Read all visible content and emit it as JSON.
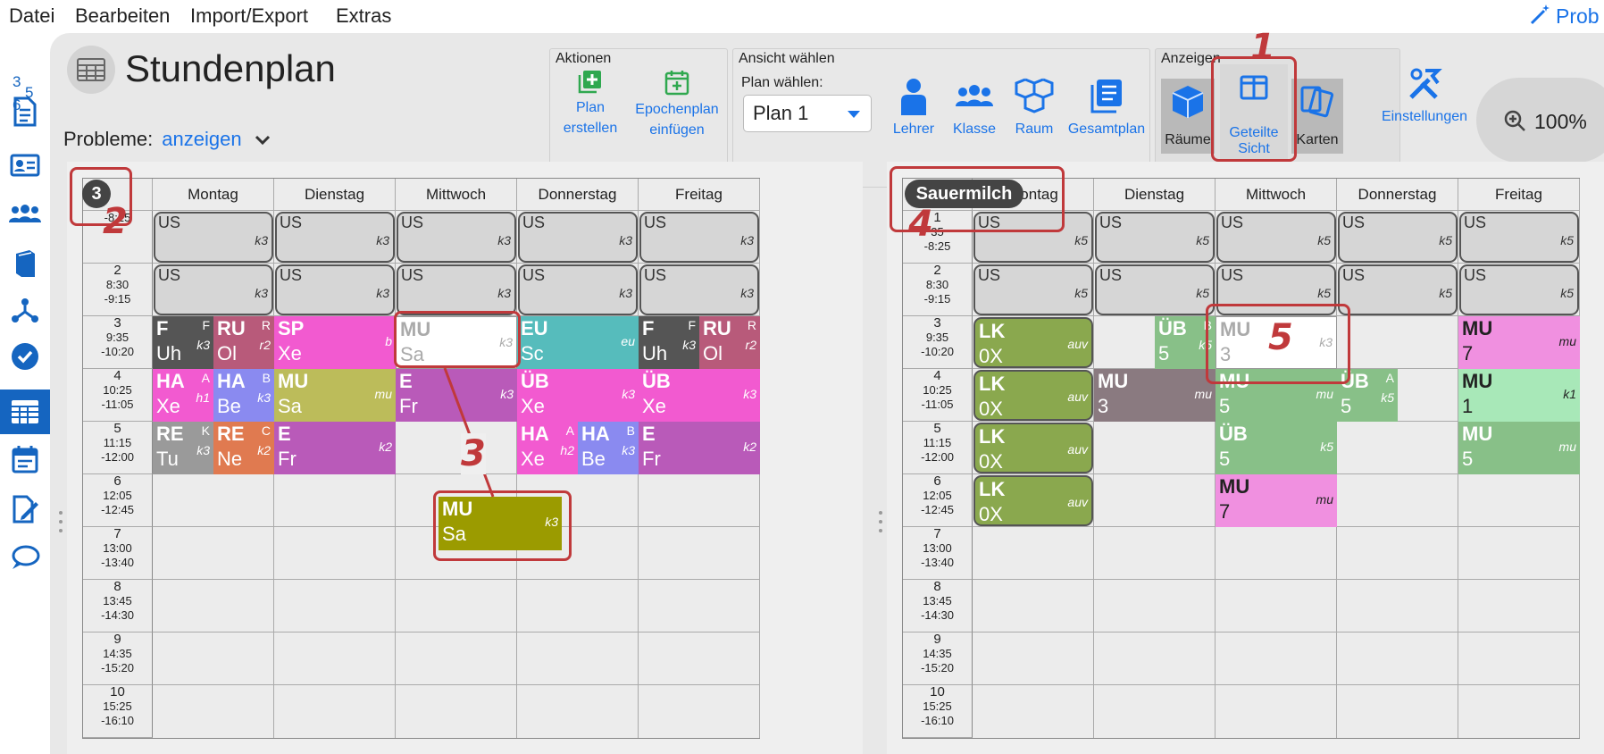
{
  "menu": [
    "Datei",
    "Bearbeiten",
    "Import/Export",
    "Extras"
  ],
  "help_label": "Prob",
  "logo_text": "365",
  "title": "Stundenplan",
  "probleme": {
    "label": "Probleme:",
    "link": "anzeigen"
  },
  "groups": {
    "aktionen": "Aktionen",
    "ansicht": "Ansicht wählen",
    "anzeigen": "Anzeigen"
  },
  "toolbar": {
    "plan_erstellen": [
      "Plan",
      "erstellen"
    ],
    "epochenplan": [
      "Epochenplan",
      "einfügen"
    ],
    "plan_label": "Plan wählen:",
    "plan_value": "Plan 1",
    "lehrer": "Lehrer",
    "klasse": "Klasse",
    "raum": "Raum",
    "gesamtplan": "Gesamtplan",
    "raeume": "Räume",
    "geteilte": [
      "Geteilte",
      "Sicht"
    ],
    "karten": "Karten",
    "einstellungen": "Einstellungen",
    "zoom": "100%"
  },
  "days": [
    "Montag",
    "Dienstag",
    "Mittwoch",
    "Donnerstag",
    "Freitag"
  ],
  "periods": [
    {
      "n": "1",
      "from": "",
      "to": "-8:25"
    },
    {
      "n": "2",
      "from": "8:30",
      "to": "-9:15"
    },
    {
      "n": "3",
      "from": "9:35",
      "to": "-10:20"
    },
    {
      "n": "4",
      "from": "10:25",
      "to": "-11:05"
    },
    {
      "n": "5",
      "from": "11:15",
      "to": "-12:00"
    },
    {
      "n": "6",
      "from": "12:05",
      "to": "-12:45"
    },
    {
      "n": "7",
      "from": "13:00",
      "to": "-13:40"
    },
    {
      "n": "8",
      "from": "13:45",
      "to": "-14:30"
    },
    {
      "n": "9",
      "from": "14:35",
      "to": "-15:20"
    },
    {
      "n": "10",
      "from": "15:25",
      "to": "-16:10"
    }
  ],
  "left_periods_p1": {
    "n": "",
    "from": "",
    "to": "-8:25"
  },
  "right_periods_p1": {
    "n": "1",
    "from": "35",
    "to": "-8:25"
  },
  "left": {
    "badge": "3",
    "lessons": [
      {
        "d": 0,
        "p": 0,
        "w": 1,
        "sub": "US",
        "rm": "k3",
        "style": "us"
      },
      {
        "d": 1,
        "p": 0,
        "w": 1,
        "sub": "US",
        "rm": "k3",
        "style": "us"
      },
      {
        "d": 2,
        "p": 0,
        "w": 1,
        "sub": "US",
        "rm": "k3",
        "style": "us"
      },
      {
        "d": 3,
        "p": 0,
        "w": 1,
        "sub": "US",
        "rm": "k3",
        "style": "us"
      },
      {
        "d": 4,
        "p": 0,
        "w": 1,
        "sub": "US",
        "rm": "k3",
        "style": "us"
      },
      {
        "d": 0,
        "p": 1,
        "w": 1,
        "sub": "US",
        "rm": "k3",
        "style": "us"
      },
      {
        "d": 1,
        "p": 1,
        "w": 1,
        "sub": "US",
        "rm": "k3",
        "style": "us"
      },
      {
        "d": 2,
        "p": 1,
        "w": 1,
        "sub": "US",
        "rm": "k3",
        "style": "us"
      },
      {
        "d": 3,
        "p": 1,
        "w": 1,
        "sub": "US",
        "rm": "k3",
        "style": "us"
      },
      {
        "d": 4,
        "p": 1,
        "w": 1,
        "sub": "US",
        "rm": "k3",
        "style": "us"
      },
      {
        "d": 0,
        "p": 2,
        "w": 0.5,
        "o": 0,
        "sub": "F",
        "tch": "Uh",
        "rm": "k3",
        "sup": "F",
        "color": "#555555"
      },
      {
        "d": 0,
        "p": 2,
        "w": 0.5,
        "o": 0.5,
        "sub": "RU",
        "tch": "Ol",
        "rm": "r2",
        "sup": "R",
        "color": "#b85a7a"
      },
      {
        "d": 1,
        "p": 2,
        "w": 1,
        "sub": "SP",
        "tch": "Xe",
        "rm": "b",
        "color": "#f25ad0"
      },
      {
        "d": 2,
        "p": 2,
        "w": 1,
        "sub": "MU",
        "tch": "Sa",
        "rm": "k3",
        "style": "ghost"
      },
      {
        "d": 3,
        "p": 2,
        "w": 1,
        "sub": "EU",
        "tch": "Sc",
        "rm": "eu",
        "color": "#56bcbc"
      },
      {
        "d": 4,
        "p": 2,
        "w": 0.5,
        "o": 0,
        "sub": "F",
        "tch": "Uh",
        "rm": "k3",
        "sup": "F",
        "color": "#555555"
      },
      {
        "d": 4,
        "p": 2,
        "w": 0.5,
        "o": 0.5,
        "sub": "RU",
        "tch": "Ol",
        "rm": "r2",
        "sup": "R",
        "color": "#b85a7a"
      },
      {
        "d": 0,
        "p": 3,
        "w": 0.5,
        "o": 0,
        "sub": "HA",
        "tch": "Xe",
        "rm": "h1",
        "sup": "A",
        "color": "#f25ad0"
      },
      {
        "d": 0,
        "p": 3,
        "w": 0.5,
        "o": 0.5,
        "sub": "HA",
        "tch": "Be",
        "rm": "k3",
        "sup": "B",
        "color": "#8a8af0"
      },
      {
        "d": 1,
        "p": 3,
        "w": 1,
        "sub": "MU",
        "tch": "Sa",
        "rm": "mu",
        "color": "#bcbc5a"
      },
      {
        "d": 2,
        "p": 3,
        "w": 1,
        "sub": "E",
        "tch": "Fr",
        "rm": "k3",
        "color": "#b95ab9"
      },
      {
        "d": 3,
        "p": 3,
        "w": 1,
        "sub": "ÜB",
        "tch": "Xe",
        "rm": "k3",
        "color": "#f25ad0"
      },
      {
        "d": 4,
        "p": 3,
        "w": 1,
        "sub": "ÜB",
        "tch": "Xe",
        "rm": "k3",
        "color": "#f25ad0"
      },
      {
        "d": 0,
        "p": 4,
        "w": 0.5,
        "o": 0,
        "sub": "RE",
        "tch": "Tu",
        "rm": "k3",
        "sup": "K",
        "color": "#9a9a9a"
      },
      {
        "d": 0,
        "p": 4,
        "w": 0.5,
        "o": 0.5,
        "sub": "RE",
        "tch": "Ne",
        "rm": "k2",
        "sup": "C",
        "color": "#e07a50"
      },
      {
        "d": 1,
        "p": 4,
        "w": 1,
        "sub": "E",
        "tch": "Fr",
        "rm": "k2",
        "color": "#b95ab9"
      },
      {
        "d": 3,
        "p": 4,
        "w": 0.5,
        "o": 0,
        "sub": "HA",
        "tch": "Xe",
        "rm": "h2",
        "sup": "A",
        "color": "#f25ad0"
      },
      {
        "d": 3,
        "p": 4,
        "w": 0.5,
        "o": 0.5,
        "sub": "HA",
        "tch": "Be",
        "rm": "k3",
        "sup": "B",
        "color": "#8a8af0"
      },
      {
        "d": 4,
        "p": 4,
        "w": 1,
        "sub": "E",
        "tch": "Fr",
        "rm": "k2",
        "color": "#b95ab9"
      }
    ],
    "dragged": {
      "sub": "MU",
      "tch": "Sa",
      "rm": "k3",
      "color": "#9b9b00"
    }
  },
  "right": {
    "badge": "Sauermilch",
    "lessons": [
      {
        "d": 0,
        "p": 0,
        "w": 1,
        "sub": "US",
        "rm": "k5",
        "style": "us"
      },
      {
        "d": 1,
        "p": 0,
        "w": 1,
        "sub": "US",
        "rm": "k5",
        "style": "us"
      },
      {
        "d": 2,
        "p": 0,
        "w": 1,
        "sub": "US",
        "rm": "k5",
        "style": "us"
      },
      {
        "d": 3,
        "p": 0,
        "w": 1,
        "sub": "US",
        "rm": "k5",
        "style": "us"
      },
      {
        "d": 4,
        "p": 0,
        "w": 1,
        "sub": "US",
        "rm": "k5",
        "style": "us"
      },
      {
        "d": 0,
        "p": 1,
        "w": 1,
        "sub": "US",
        "rm": "k5",
        "style": "us"
      },
      {
        "d": 1,
        "p": 1,
        "w": 1,
        "sub": "US",
        "rm": "k5",
        "style": "us"
      },
      {
        "d": 2,
        "p": 1,
        "w": 1,
        "sub": "US",
        "rm": "k5",
        "style": "us"
      },
      {
        "d": 3,
        "p": 1,
        "w": 1,
        "sub": "US",
        "rm": "k5",
        "style": "us"
      },
      {
        "d": 4,
        "p": 1,
        "w": 1,
        "sub": "US",
        "rm": "k5",
        "style": "us"
      },
      {
        "d": 0,
        "p": 2,
        "w": 1,
        "sub": "LK",
        "tch": "0X",
        "rm": "auv",
        "color": "#8aa84e",
        "style": "rounded"
      },
      {
        "d": 1,
        "p": 2,
        "w": 0.5,
        "o": 0.5,
        "sub": "ÜB",
        "tch": "5",
        "rm": "k5",
        "sup": "B",
        "color": "#88c088"
      },
      {
        "d": 2,
        "p": 2,
        "w": 1,
        "sub": "MU",
        "tch": "3",
        "rm": "k3",
        "style": "ghost"
      },
      {
        "d": 4,
        "p": 2,
        "w": 1,
        "sub": "MU",
        "tch": "7",
        "rm": "mu",
        "color": "#f090e0",
        "dark": true
      },
      {
        "d": 0,
        "p": 3,
        "w": 1,
        "sub": "LK",
        "tch": "0X",
        "rm": "auv",
        "color": "#8aa84e",
        "style": "rounded"
      },
      {
        "d": 1,
        "p": 3,
        "w": 1,
        "sub": "MU",
        "tch": "3",
        "rm": "mu",
        "color": "#8a7a80"
      },
      {
        "d": 2,
        "p": 3,
        "w": 1,
        "sub": "MU",
        "tch": "5",
        "rm": "mu",
        "color": "#88c088"
      },
      {
        "d": 3,
        "p": 3,
        "w": 0.5,
        "o": 0,
        "sub": "ÜB",
        "tch": "5",
        "rm": "k5",
        "sup": "A",
        "color": "#88c088"
      },
      {
        "d": 4,
        "p": 3,
        "w": 1,
        "sub": "MU",
        "tch": "1",
        "rm": "k1",
        "color": "#a8e8b8",
        "dark": true
      },
      {
        "d": 0,
        "p": 4,
        "w": 1,
        "sub": "LK",
        "tch": "0X",
        "rm": "auv",
        "color": "#8aa84e",
        "style": "rounded"
      },
      {
        "d": 2,
        "p": 4,
        "w": 1,
        "sub": "ÜB",
        "tch": "5",
        "rm": "k5",
        "color": "#88c088"
      },
      {
        "d": 4,
        "p": 4,
        "w": 1,
        "sub": "MU",
        "tch": "5",
        "rm": "mu",
        "color": "#88c088"
      },
      {
        "d": 0,
        "p": 5,
        "w": 1,
        "sub": "LK",
        "tch": "0X",
        "rm": "auv",
        "color": "#8aa84e",
        "style": "rounded"
      },
      {
        "d": 2,
        "p": 5,
        "w": 1,
        "sub": "MU",
        "tch": "7",
        "rm": "mu",
        "color": "#f090e0",
        "dark": true
      }
    ]
  },
  "annotations": [
    "1",
    "2",
    "3",
    "4",
    "5"
  ],
  "colors": {
    "accent": "#1a73e8",
    "annotation": "#c0393b",
    "sidebar_active": "#1565c0"
  }
}
